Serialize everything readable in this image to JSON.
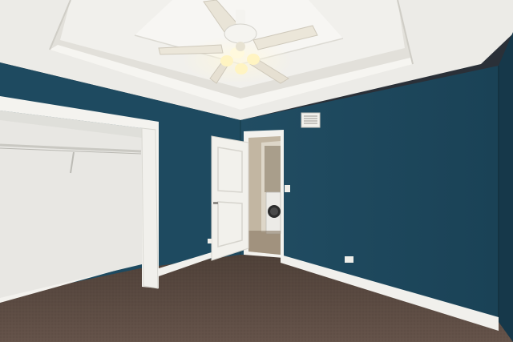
{
  "scene": {
    "subject": "empty-bedroom-photo",
    "colors": {
      "wall": "#1f4a60",
      "wall_dark": "#193d50",
      "ceiling": "#eeece8",
      "trim": "#f4f3ef",
      "carpet": "#5a4a40",
      "closet_wall": "#e9e8e4",
      "door": "#f2f1ec",
      "hall": "#bfb39f",
      "light_glow": "#fff3c6"
    }
  }
}
